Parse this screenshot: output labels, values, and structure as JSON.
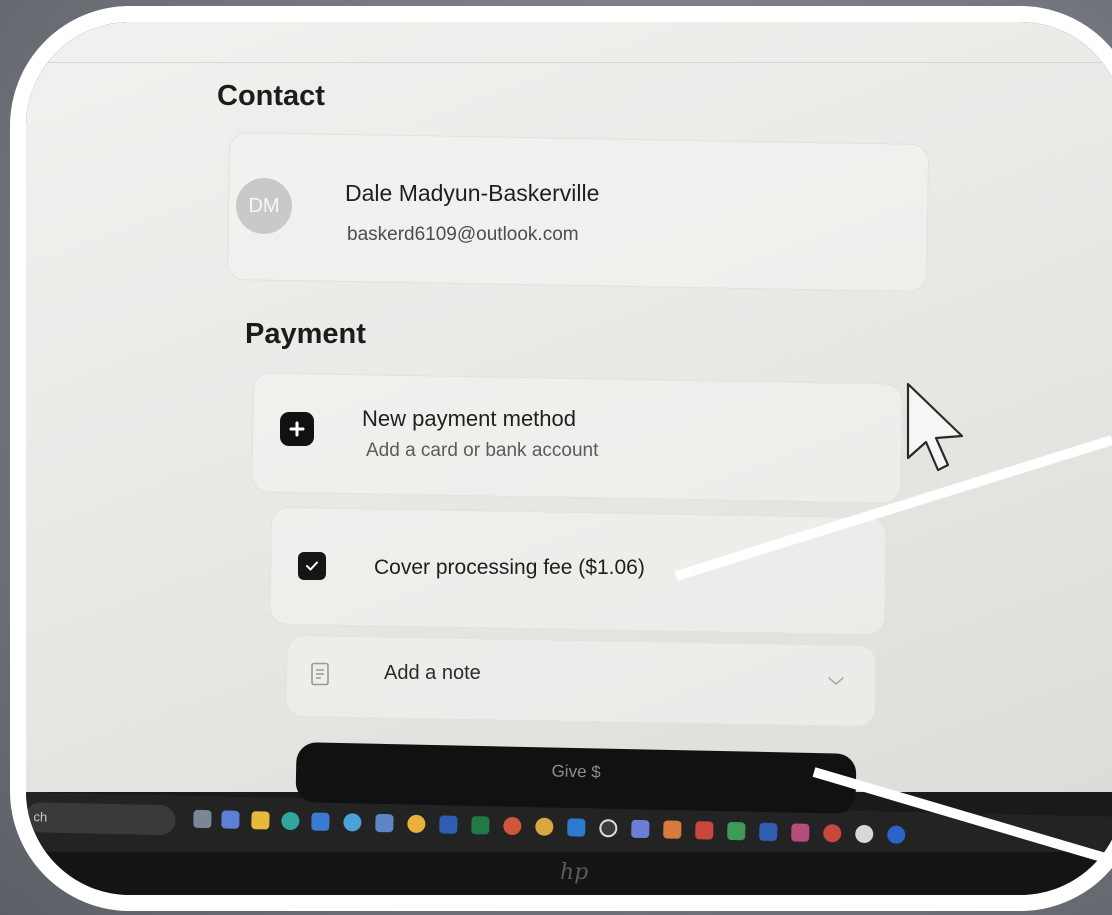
{
  "contact": {
    "section_title": "Contact",
    "avatar_initials": "DM",
    "name": "Dale Madyun-Baskerville",
    "email": "baskerd6109@outlook.com"
  },
  "payment": {
    "section_title": "Payment",
    "new_method_title": "New payment method",
    "new_method_subtitle": "Add a card or bank account"
  },
  "processing_fee": {
    "label": "Cover processing fee ($1.06)",
    "checked": true
  },
  "note": {
    "label": "Add a note"
  },
  "give_button": {
    "label": "Give $"
  },
  "taskbar": {
    "search_text": "ch"
  },
  "bezel": {
    "logo": "hp"
  },
  "colors": {
    "annotation": "#ffffff",
    "button_bg": "#111111"
  }
}
